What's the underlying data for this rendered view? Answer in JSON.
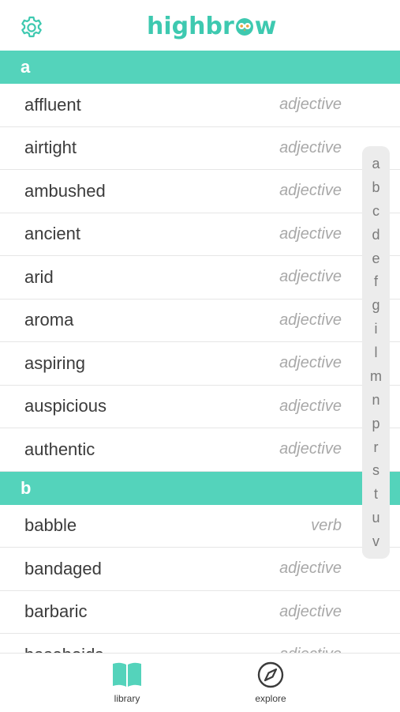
{
  "header": {
    "settings_icon": "gear-icon",
    "logo_parts": [
      "highbr",
      "w"
    ],
    "brand_color": "#3ec9b0"
  },
  "sections": [
    {
      "letter": "a",
      "rows": [
        {
          "word": "affluent",
          "pos": "adjective"
        },
        {
          "word": "airtight",
          "pos": "adjective"
        },
        {
          "word": "ambushed",
          "pos": "adjective"
        },
        {
          "word": "ancient",
          "pos": "adjective"
        },
        {
          "word": "arid",
          "pos": "adjective"
        },
        {
          "word": "aroma",
          "pos": "adjective"
        },
        {
          "word": "aspiring",
          "pos": "adjective"
        },
        {
          "word": "auspicious",
          "pos": "adjective"
        },
        {
          "word": "authentic",
          "pos": "adjective"
        }
      ]
    },
    {
      "letter": "b",
      "rows": [
        {
          "word": "babble",
          "pos": "verb"
        },
        {
          "word": "bandaged",
          "pos": "adjective"
        },
        {
          "word": "barbaric",
          "pos": "adjective"
        },
        {
          "word": "baseboids",
          "pos": "adjective"
        }
      ]
    }
  ],
  "index_letters": [
    "a",
    "b",
    "c",
    "d",
    "e",
    "f",
    "g",
    "i",
    "l",
    "m",
    "n",
    "p",
    "r",
    "s",
    "t",
    "u",
    "v"
  ],
  "tabs": [
    {
      "label": "library",
      "icon": "book-icon"
    },
    {
      "label": "explore",
      "icon": "compass-icon"
    }
  ],
  "colors": {
    "section_header": "#54d3bb",
    "word_text": "#3b3b3b",
    "pos_text": "#a8a8a8"
  }
}
